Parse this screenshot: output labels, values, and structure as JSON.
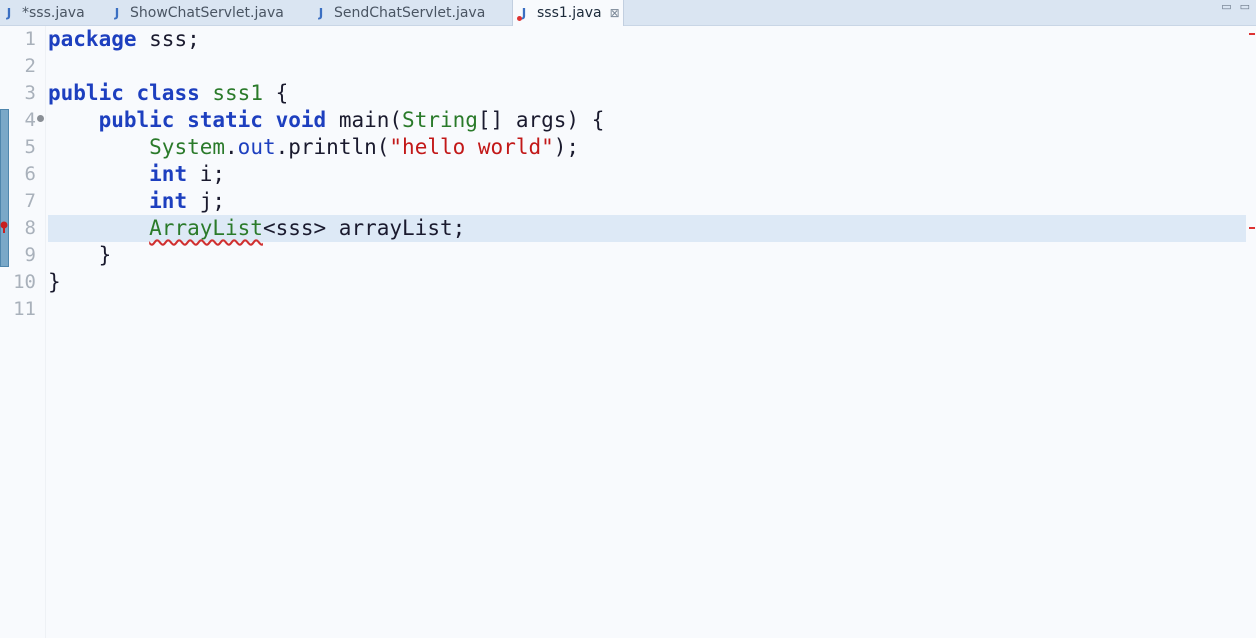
{
  "tabs": [
    {
      "label": "*sss.java",
      "active": false
    },
    {
      "label": "ShowChatServlet.java",
      "active": false
    },
    {
      "label": "SendChatServlet.java",
      "active": false
    },
    {
      "label": "sss1.java",
      "active": true,
      "close": "⊠"
    }
  ],
  "window_controls": {
    "minimize": "▭",
    "maximize": "▭"
  },
  "line_numbers": [
    "1",
    "2",
    "3",
    "4",
    "5",
    "6",
    "7",
    "8",
    "9",
    "10",
    "11"
  ],
  "code": {
    "l1": {
      "kw": "package",
      "rest": " sss;"
    },
    "l3": {
      "kw1": "public",
      "kw2": "class",
      "cls": "sss1",
      "rest": " {"
    },
    "l4": {
      "kw1": "public",
      "kw2": "static",
      "kw3": "void",
      "rest1": " main(",
      "cls": "String",
      "rest2": "[] args) {"
    },
    "l5": {
      "cls": "System",
      "dot": ".",
      "fld": "out",
      "rest": ".println(",
      "str": "\"hello world\"",
      "end": ");"
    },
    "l6": {
      "kw": "int",
      "rest": " i;"
    },
    "l7": {
      "kw": "int",
      "rest": " j;"
    },
    "l8": {
      "cls": "ArrayList",
      "rest": "<sss> arrayList;"
    },
    "l9": {
      "rest": "}"
    },
    "l10": {
      "rest": "}"
    }
  },
  "colors": {
    "keyword": "#1d3fbf",
    "class": "#2a7a2a",
    "string": "#c21818",
    "current_line": "#dde9f6"
  }
}
